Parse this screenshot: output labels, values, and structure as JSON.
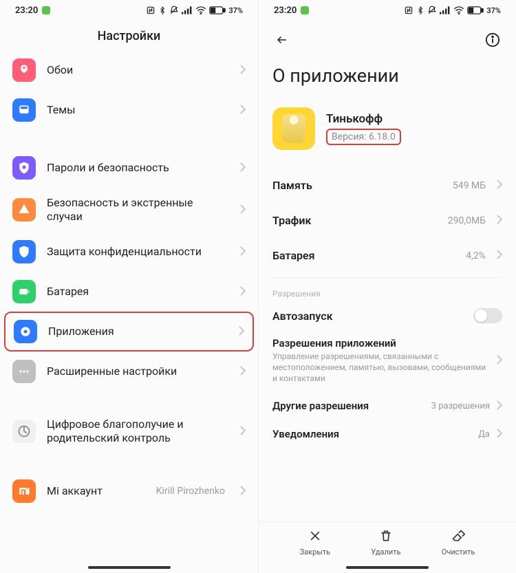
{
  "status": {
    "time": "23:20",
    "battery": "37%"
  },
  "left": {
    "header": "Настройки",
    "items": {
      "wallpaper": "Обои",
      "themes": "Темы",
      "passwords": "Пароли и безопасность",
      "emergency": "Безопасность и экстренные случаи",
      "privacy": "Защита конфиденциальности",
      "battery": "Батарея",
      "apps": "Приложения",
      "advanced": "Расширенные настройки",
      "wellbeing": "Цифровое благополучие и родительский контроль",
      "mi_account": "Mi аккаунт"
    },
    "mi_value": "Kirill Pirozhenko"
  },
  "right": {
    "title": "О приложении",
    "app_name": "Тинькофф",
    "app_version": "Версия: 6.18.0",
    "memory_label": "Память",
    "memory_value": "549 МБ",
    "traffic_label": "Трафик",
    "traffic_value": "290,0МБ",
    "battery_label": "Батарея",
    "battery_value": "4,2%",
    "permissions_caption": "Разрешения",
    "autostart_label": "Автозапуск",
    "app_perms_title": "Разрешения приложений",
    "app_perms_desc": "Управление разрешениями, связанными с местоположением, памятью, вызовами, сообщениями и контактами",
    "other_perms_title": "Другие разрешения",
    "other_perms_value": "3 разрешения",
    "notifications_label": "Уведомления",
    "notifications_value": "Да",
    "actions": {
      "close": "Закрыть",
      "delete": "Удалить",
      "clear": "Очистить"
    }
  },
  "colors": {
    "wallpaper": "#ff5d78",
    "themes": "#2f7bff",
    "passwords": "#7d5cff",
    "emergency": "#ff8a3d",
    "privacy": "#2f7bff",
    "battery": "#2fcf6a",
    "apps": "#2f7bff",
    "advanced": "#bfbfbf",
    "wellbeing": "#bfbfbf",
    "mi": "#ff7a2a"
  }
}
